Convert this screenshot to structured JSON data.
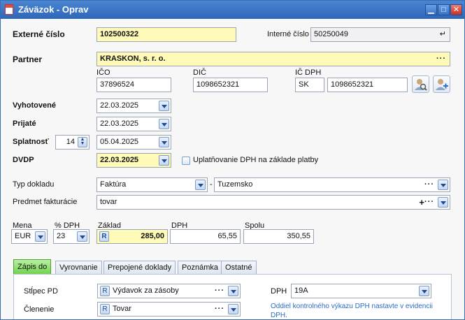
{
  "window": {
    "title": "Záväzok - Oprav"
  },
  "form": {
    "externe_cislo": {
      "label": "Externé číslo",
      "value": "102500322"
    },
    "interne_cislo": {
      "label": "Interné číslo",
      "value": "50250049"
    },
    "partner": {
      "label": "Partner",
      "value": "KRASKON, s. r. o."
    },
    "ico": {
      "label": "IČO",
      "value": "37896524"
    },
    "dic": {
      "label": "DIČ",
      "value": "1098652321"
    },
    "ic_dph": {
      "label": "IČ DPH",
      "prefix": "SK",
      "value": "1098652321"
    },
    "vyhotovene": {
      "label": "Vyhotovené",
      "value": "22.03.2025"
    },
    "prijate": {
      "label": "Prijaté",
      "value": "22.03.2025"
    },
    "splatnost": {
      "label": "Splatnosť",
      "days": "14",
      "value": "05.04.2025"
    },
    "dvdp": {
      "label": "DVDP",
      "value": "22.03.2025"
    },
    "uplatnovanie": {
      "label": "Uplatňovanie DPH na základe platby"
    },
    "typ_dokladu": {
      "label": "Typ dokladu",
      "value": "Faktúra",
      "separator": "-",
      "region": "Tuzemsko"
    },
    "predmet": {
      "label": "Predmet fakturácie",
      "value": "tovar",
      "plus": "+"
    },
    "amounts": {
      "mena_label": "Mena",
      "mena": "EUR",
      "pct_label": "% DPH",
      "pct": "23",
      "zaklad_label": "Základ",
      "zaklad": "285,00",
      "dph_label": "DPH",
      "dph": "65,55",
      "spolu_label": "Spolu",
      "spolu": "350,55"
    },
    "r_badge": "R",
    "dots": "···"
  },
  "tabs": [
    "Zápis do",
    "Vyrovnanie",
    "Prepojené doklady",
    "Poznámka",
    "Ostatné"
  ],
  "tab_panel": {
    "stlpec_label": "Stĺpec PD",
    "stlpec": "Výdavok za zásoby",
    "clenenie_label": "Členenie",
    "clenenie": "Tovar",
    "dph_label": "DPH",
    "dph": "19A",
    "hint": "Oddiel kontrolného výkazu DPH nastavte v evidencii DPH."
  },
  "colors": {
    "titlebar": "#3a74c6",
    "required_field": "#fffab8",
    "active_tab": "#6fd14c"
  }
}
